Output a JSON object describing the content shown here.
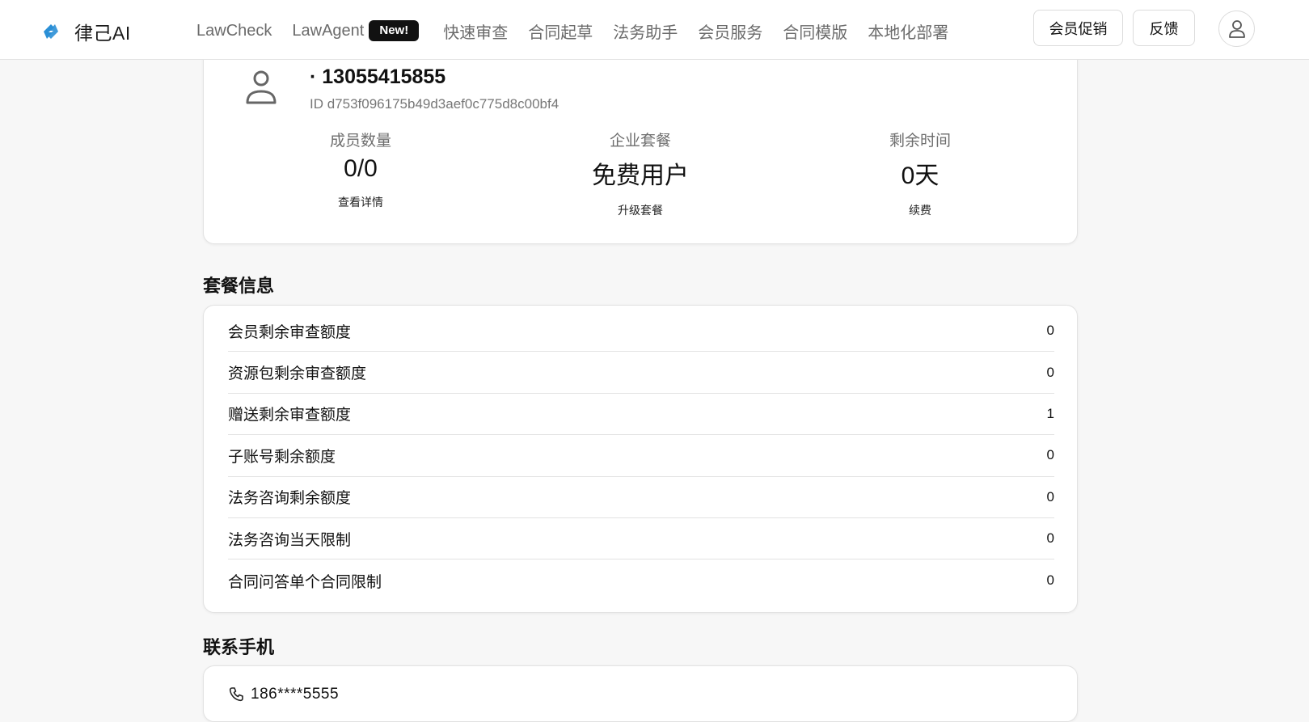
{
  "header": {
    "brand_name": "律己AI",
    "nav": [
      {
        "label": "LawCheck"
      },
      {
        "label": "LawAgent",
        "badge": "New!"
      },
      {
        "label": "快速审查"
      },
      {
        "label": "合同起草"
      },
      {
        "label": "法务助手"
      },
      {
        "label": "会员服务"
      },
      {
        "label": "合同模版"
      },
      {
        "label": "本地化部署"
      }
    ],
    "promo_button": "会员促销",
    "feedback_button": "反馈",
    "accent_color": "#2b8fd6"
  },
  "profile": {
    "phone": "· 13055415855",
    "user_id": "ID d753f096175b49d3aef0c775d8c00bf4",
    "stats": [
      {
        "label": "成员数量",
        "value": "0/0",
        "link": "查看详情"
      },
      {
        "label": "企业套餐",
        "value": "免费用户",
        "link": "升级套餐"
      },
      {
        "label": "剩余时间",
        "value": "0天",
        "link": "续费"
      }
    ]
  },
  "plan": {
    "title": "套餐信息",
    "rows": [
      {
        "label": "会员剩余审查额度",
        "value": "0"
      },
      {
        "label": "资源包剩余审查额度",
        "value": "0"
      },
      {
        "label": "赠送剩余审查额度",
        "value": "1"
      },
      {
        "label": "子账号剩余额度",
        "value": "0"
      },
      {
        "label": "法务咨询剩余额度",
        "value": "0"
      },
      {
        "label": "法务咨询当天限制",
        "value": "0"
      },
      {
        "label": "合同问答单个合同限制",
        "value": "0"
      }
    ]
  },
  "contact": {
    "title": "联系手机",
    "phone": "186****5555"
  }
}
